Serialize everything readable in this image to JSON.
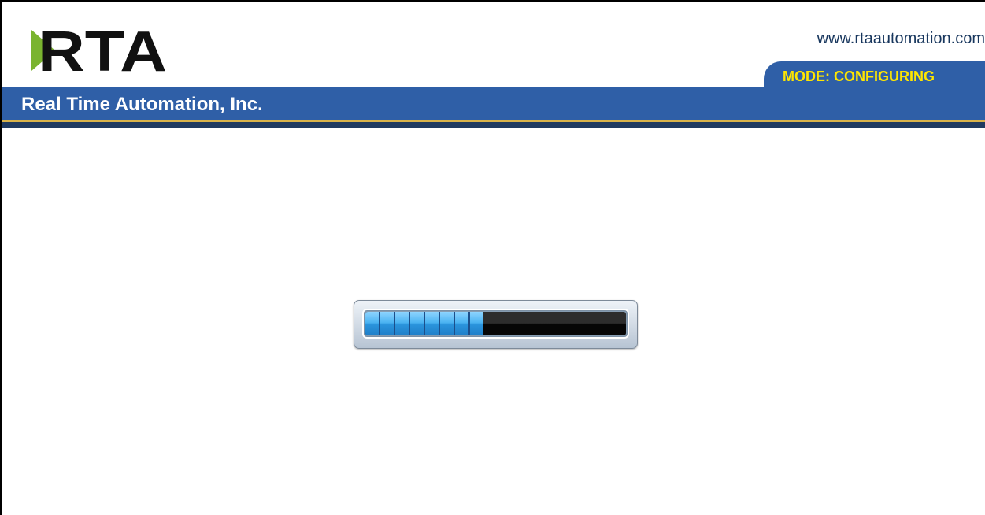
{
  "header": {
    "logo_text": "RTA",
    "site_url": "www.rtaautomation.com",
    "mode_label": "MODE: CONFIGURING",
    "company_name": "Real Time Automation, Inc."
  },
  "colors": {
    "header_blue": "#2f5fa7",
    "mode_text": "#ffe600",
    "logo_green": "#7ab42f",
    "gold_rule": "#d8b24a",
    "progress_fill": "#4cb4f2"
  },
  "loader": {
    "progress_fraction": 0.45
  }
}
